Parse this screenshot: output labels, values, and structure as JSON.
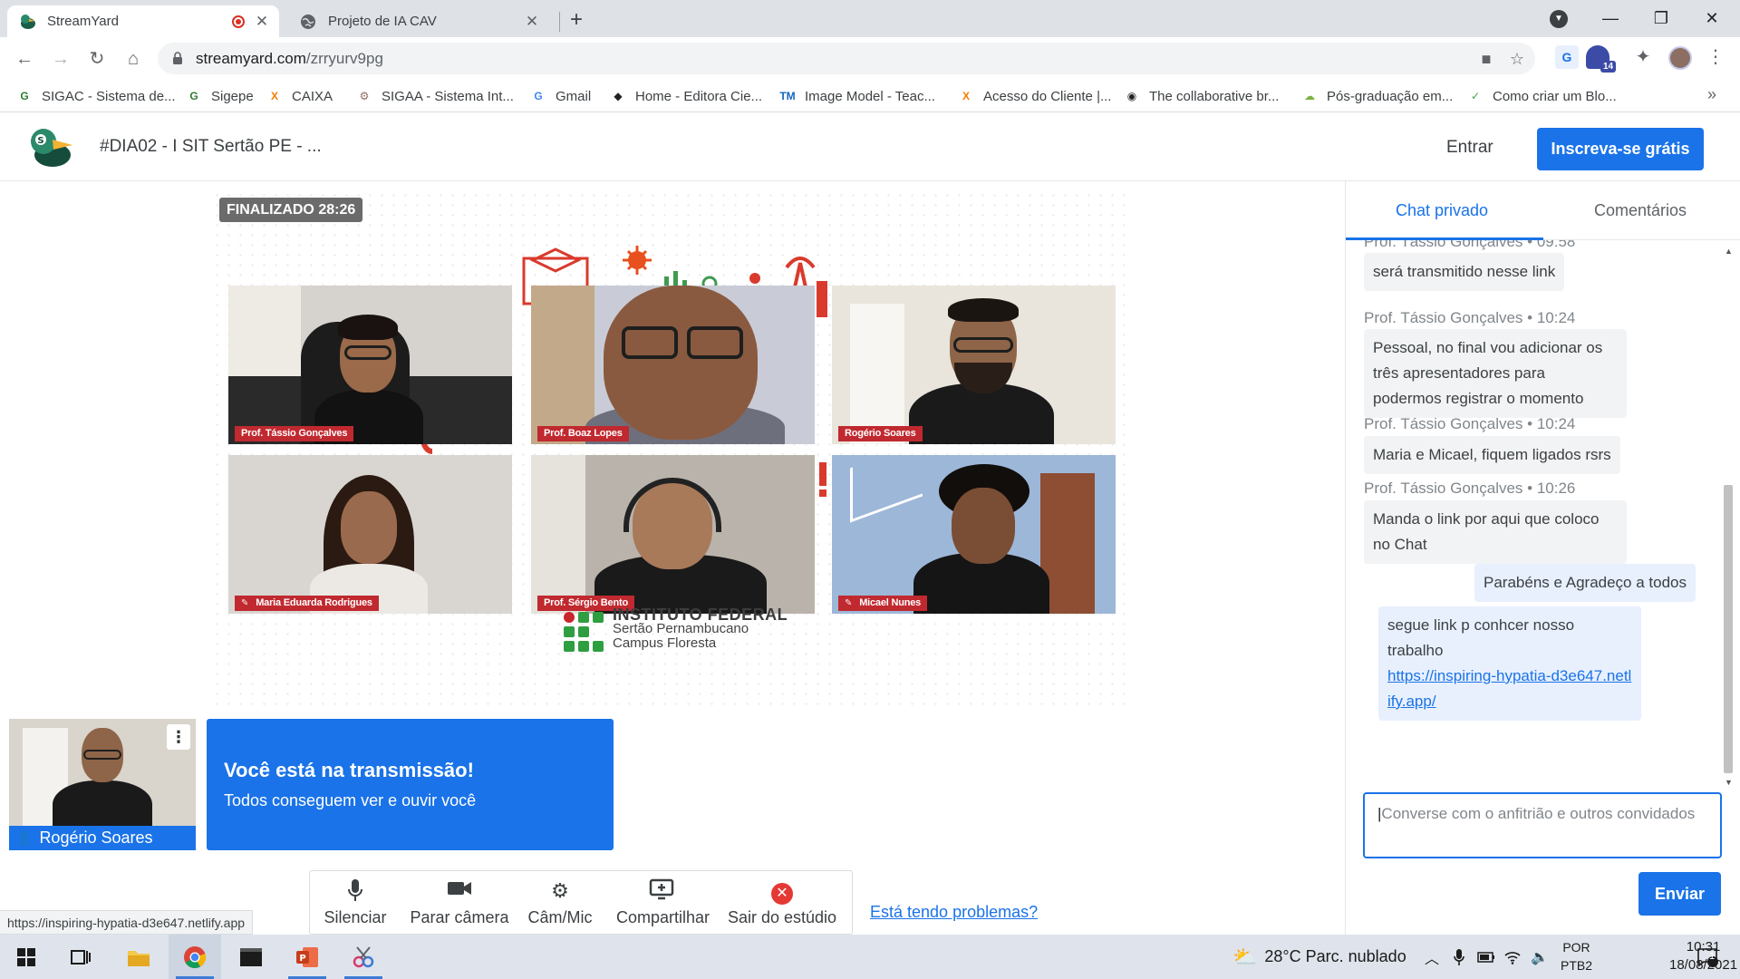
{
  "browser": {
    "tabs": [
      {
        "title": "StreamYard",
        "active": true,
        "recording": true
      },
      {
        "title": "Projeto de IA CAV",
        "active": false
      }
    ],
    "url_host": "streamyard.com",
    "url_path": "/zrryurv9pg",
    "extension_badge": "14",
    "bookmarks": [
      {
        "label": "SIGAC - Sistema de...",
        "icon": "sigac-icon",
        "color": "#2e7d32"
      },
      {
        "label": "Sigepe",
        "icon": "sigepe-icon",
        "color": "#2e7d32"
      },
      {
        "label": "CAIXA",
        "icon": "caixa-icon",
        "color": "#f57c00"
      },
      {
        "label": "SIGAA - Sistema Int...",
        "icon": "sigaa-icon",
        "color": "#8d6e63"
      },
      {
        "label": "Gmail",
        "icon": "google-icon",
        "color": "#4285f4"
      },
      {
        "label": "Home - Editora Cie...",
        "icon": "diamond-icon",
        "color": "#222222"
      },
      {
        "label": "Image Model - Teac...",
        "icon": "tm-icon",
        "color": "#1565c0"
      },
      {
        "label": "Acesso do Cliente |...",
        "icon": "caixa-icon",
        "color": "#f57c00"
      },
      {
        "label": "The collaborative br...",
        "icon": "camera-icon",
        "color": "#222222"
      },
      {
        "label": "Pós-graduação em...",
        "icon": "cloud-icon",
        "color": "#7cb342"
      },
      {
        "label": "Como criar um Blo...",
        "icon": "check-circle-icon",
        "color": "#43a047"
      }
    ]
  },
  "header": {
    "title": "#DIA02 - I SIT Sertão PE - ...",
    "login": "Entrar",
    "signup": "Inscreva-se grátis"
  },
  "stage": {
    "status": "FINALIZADO 28:26",
    "participants": [
      {
        "name": "Prof. Tássio Gonçalves",
        "muted": false
      },
      {
        "name": "Prof. Boaz Lopes",
        "muted": false
      },
      {
        "name": "Rogério Soares",
        "muted": false
      },
      {
        "name": "Maria Eduarda Rodrigues",
        "muted": true
      },
      {
        "name": "Prof. Sérgio Bento",
        "muted": false
      },
      {
        "name": "Micael Nunes",
        "muted": true
      }
    ],
    "logo": {
      "line1": "INSTITUTO FEDERAL",
      "line2": "Sertão Pernambucano",
      "line3": "Campus Floresta"
    }
  },
  "self_view": {
    "name": "Rogério Soares"
  },
  "banner": {
    "title": "Você está na transmissão!",
    "subtitle": "Todos conseguem ver e ouvir você"
  },
  "controls": {
    "mute": "Silenciar",
    "camera": "Parar câmera",
    "settings": "Câm/Mic",
    "share": "Compartilhar",
    "exit": "Sair do estúdio",
    "help_link": "Está tendo problemas?"
  },
  "status_url": "https://inspiring-hypatia-d3e647.netlify.app",
  "chat": {
    "tab_private": "Chat privado",
    "tab_comments": "Comentários",
    "messages": [
      {
        "author": "Prof. Tássio Gonçalves",
        "time": "09:58",
        "text": "será transmitido nesse link"
      },
      {
        "author": "Prof. Tássio Gonçalves",
        "time": "10:24",
        "text": "Pessoal, no final vou adicionar os três apresentadores para podermos registrar o momento"
      },
      {
        "author": "Prof. Tássio Gonçalves",
        "time": "10:24",
        "text": "Maria e Micael, fiquem ligados rsrs"
      },
      {
        "author": "Prof. Tássio Gonçalves",
        "time": "10:26",
        "text": "Manda o link por aqui que coloco no Chat"
      }
    ],
    "my_messages": [
      {
        "text": "Parabéns e Agradeço a todos"
      },
      {
        "text": "segue link p conhcer nosso trabalho",
        "link": "https://inspiring-hypatia-d3e647.netlify.app/"
      }
    ],
    "input_placeholder": "Converse com o anfitrião e outros convidados",
    "send": "Enviar"
  },
  "taskbar": {
    "weather": "28°C  Parc. nublado",
    "lang1": "POR",
    "lang2": "PTB2",
    "time": "10:31",
    "date": "18/08/2021",
    "notifications": "1"
  }
}
